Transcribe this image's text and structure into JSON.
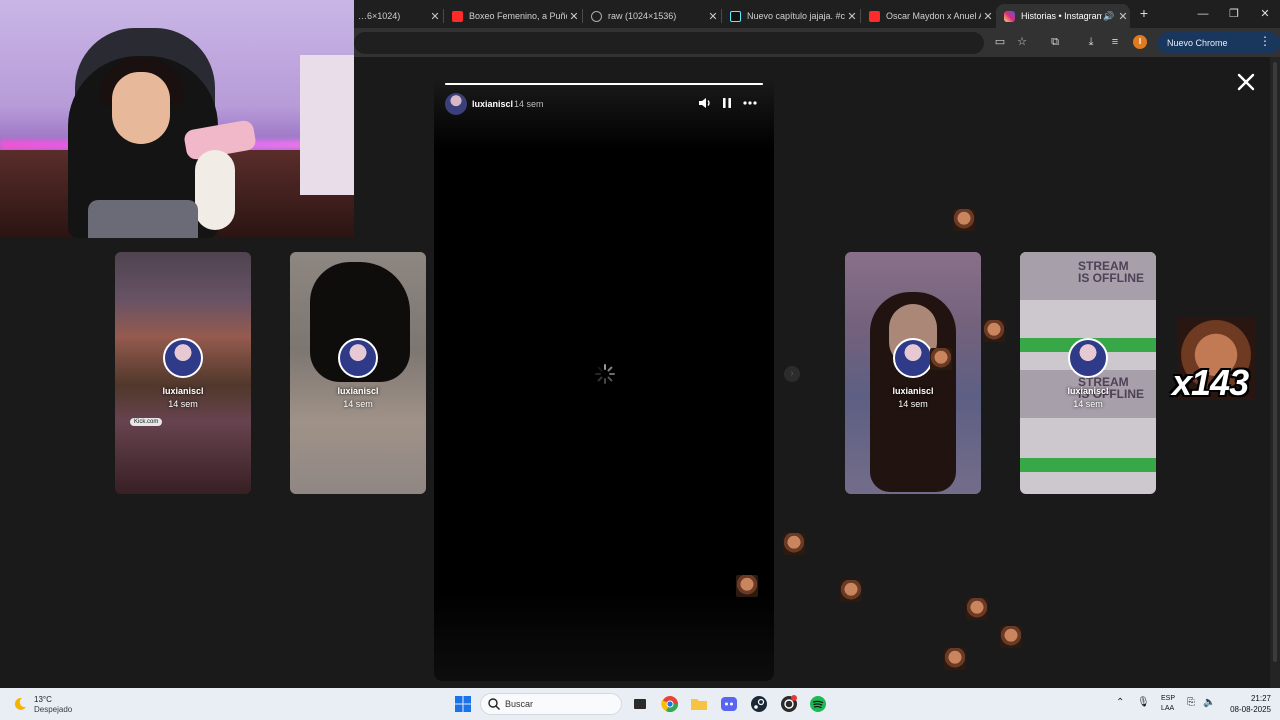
{
  "browser": {
    "tabs": [
      {
        "title": "…6×1024)",
        "icon": "image-icon"
      },
      {
        "title": "Boxeo Femenino, a Puño",
        "icon": "youtube-icon"
      },
      {
        "title": "raw (1024×1536)",
        "icon": "globe-icon"
      },
      {
        "title": "Nuevo capítulo jajaja. #cl",
        "icon": "tiktok-icon"
      },
      {
        "title": "Oscar Maydon x Anuel AA",
        "icon": "youtube-icon"
      },
      {
        "title": "Historias • Instagram",
        "icon": "instagram-icon",
        "active": true
      }
    ],
    "update_label": "Nuevo Chrome disponible",
    "profile_initial": "I"
  },
  "story": {
    "username": "luxianiscl",
    "time": "14 sem",
    "progress": 1.0
  },
  "previews": [
    {
      "username": "luxianiscl",
      "time": "14 sem",
      "badge": "Kick.com"
    },
    {
      "username": "luxianiscl",
      "time": "14 sem"
    },
    {
      "username": "luxianiscl",
      "time": "14 sem"
    },
    {
      "username": "luxianiscl",
      "time": "14 sem",
      "banner_lines": [
        "STREAM",
        "IS OFFLINE"
      ]
    }
  ],
  "overlay": {
    "combo_text": "x143"
  },
  "taskbar": {
    "weather_temp": "13°C",
    "weather_desc": "Despejado",
    "search_placeholder": "Buscar",
    "lang_top": "ESP",
    "lang_bottom": "LAA",
    "time": "21:27",
    "date": "08-08-2025"
  },
  "colors": {
    "accent_instagram": "#dd2a7b",
    "chrome_update_bg": "#19365c",
    "taskbar_bg": "#e9eef5"
  }
}
